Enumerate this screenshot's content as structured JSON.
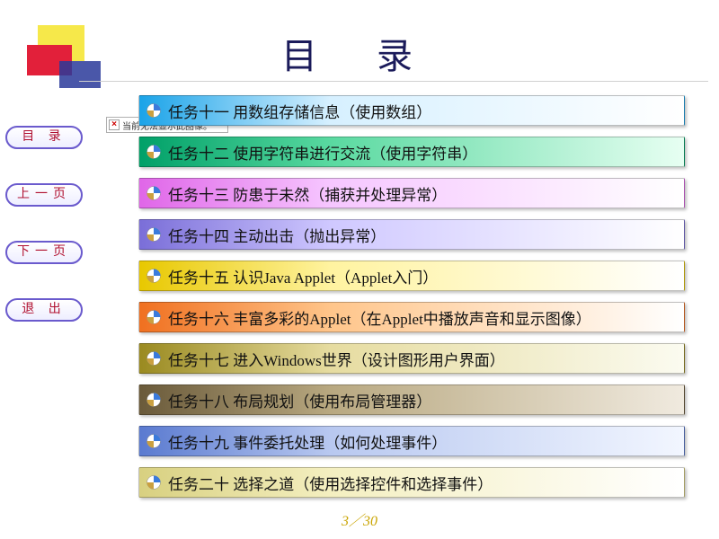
{
  "title": "目 录",
  "broken_image_text": "当前无法显示此图像。",
  "nav": {
    "toc": "目 录",
    "prev": "上一页",
    "next": "下一页",
    "exit": "退 出"
  },
  "tasks": [
    "任务十一 用数组存储信息（使用数组）",
    "任务十二 使用字符串进行交流（使用字符串）",
    "任务十三 防患于未然（捕获并处理异常）",
    "任务十四 主动出击（抛出异常）",
    "任务十五 认识Java Applet（Applet入门）",
    "任务十六 丰富多彩的Applet（在Applet中播放声音和显示图像）",
    "任务十七 进入Windows世界（设计图形用户界面）",
    "任务十八 布局规划（使用布局管理器）",
    "任务十九 事件委托处理（如何处理事件）",
    "任务二十 选择之道（使用选择控件和选择事件）"
  ],
  "page": {
    "current": "3",
    "sep": "／",
    "total": "30"
  },
  "colors": {
    "title": "#1a1a5a",
    "nav_border": "#6a5acd",
    "nav_text": "#b01030",
    "footer": "#c9a400"
  }
}
